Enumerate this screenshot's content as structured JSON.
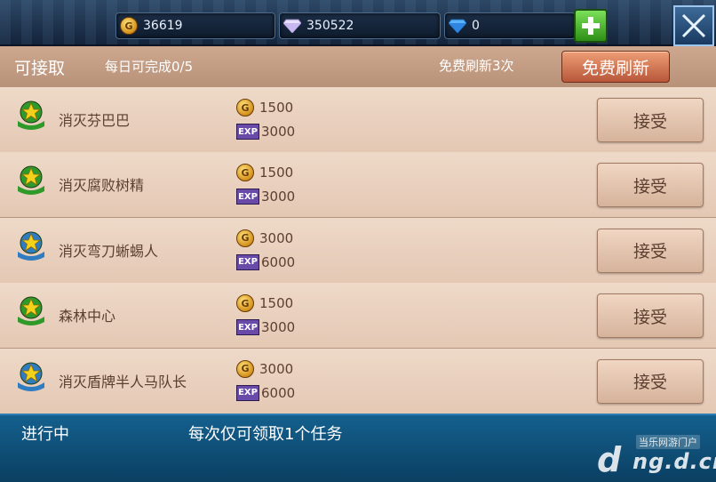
{
  "resources": {
    "gold": "36619",
    "diamond": "350522",
    "blue_gem": "0"
  },
  "header": {
    "tab_label": "可接取",
    "daily_progress": "每日可完成0/5",
    "refresh_note": "免费刷新3次",
    "refresh_button": "免费刷新"
  },
  "quests": [
    {
      "name": "消灭芬巴巴",
      "gold": "1500",
      "exp": "3000",
      "badge": "green",
      "accept": "接受"
    },
    {
      "name": "消灭腐败树精",
      "gold": "1500",
      "exp": "3000",
      "badge": "green",
      "accept": "接受"
    },
    {
      "name": "消灭弯刀蜥蜴人",
      "gold": "3000",
      "exp": "6000",
      "badge": "blue",
      "accept": "接受"
    },
    {
      "name": "森林中心",
      "gold": "1500",
      "exp": "3000",
      "badge": "green",
      "accept": "接受"
    },
    {
      "name": "消灭盾牌半人马队长",
      "gold": "3000",
      "exp": "6000",
      "badge": "blue",
      "accept": "接受"
    }
  ],
  "bottom": {
    "status_label": "进行中",
    "note": "每次仅可领取1个任务"
  },
  "labels": {
    "coin_glyph": "G",
    "exp_tag": "EXP"
  },
  "watermark": {
    "top": "当乐网游门户",
    "main": "ng.d.cn",
    "logo": "d"
  },
  "colors": {
    "green_badge": "#2f9a2a",
    "blue_badge": "#2f7cc0",
    "star": "#f4d21c"
  }
}
